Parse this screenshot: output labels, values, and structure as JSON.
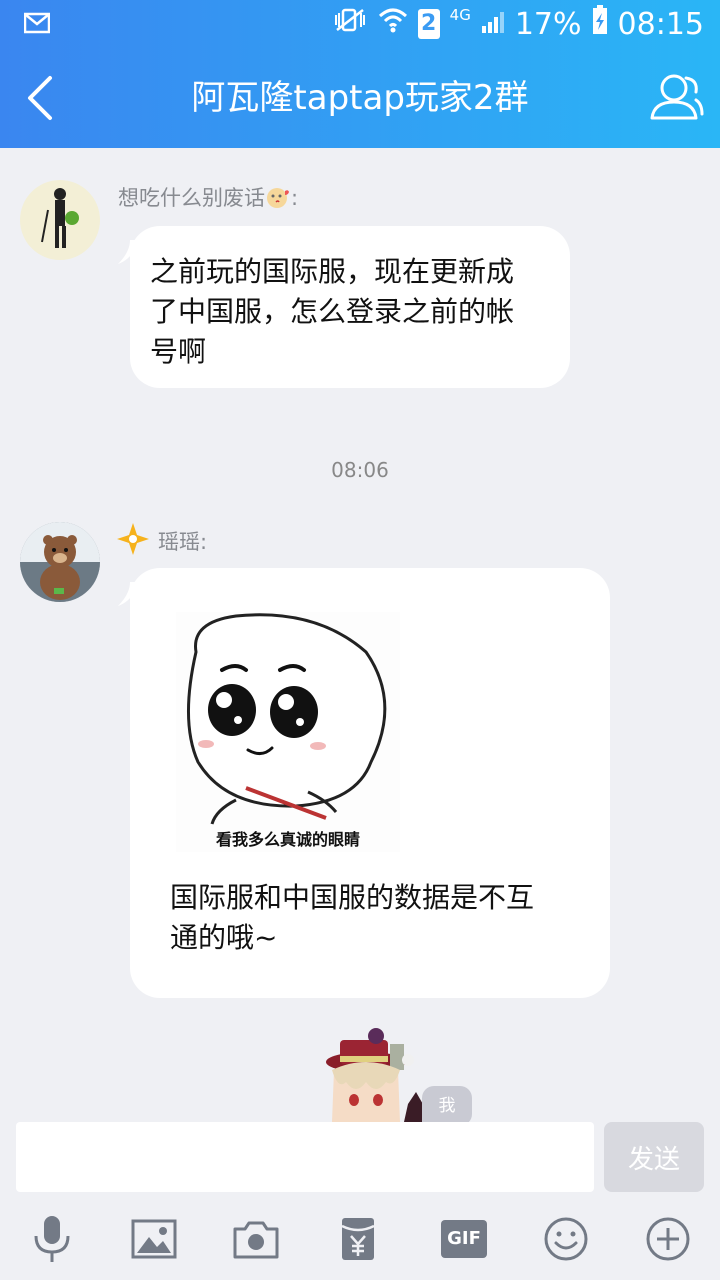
{
  "status_bar": {
    "sim_slot": "2",
    "network": "4G",
    "battery": "17%",
    "time": "08:15"
  },
  "header": {
    "title": "阿瓦隆taptap玩家2群"
  },
  "messages": [
    {
      "sender": "想吃什么别废话",
      "lines": [
        "之前玩的国际服，现在更新成",
        "了中国服，怎么登录之前的帐",
        "号啊"
      ]
    },
    {
      "sender": "瑶瑶:",
      "sticker_caption": "看我多么真诚的眼睛",
      "lines": [
        "国际服和中国服的数据是不互",
        "通的哦~"
      ]
    }
  ],
  "timestamp": "08:06",
  "me_tag": "我",
  "composer": {
    "placeholder": "",
    "send_label": "发送"
  },
  "toolbar": {
    "gif_label": "GIF"
  },
  "colors": {
    "header_start": "#3a86f0",
    "header_end": "#2ab6f6",
    "background": "#eff0f4",
    "bubble": "#ffffff"
  }
}
